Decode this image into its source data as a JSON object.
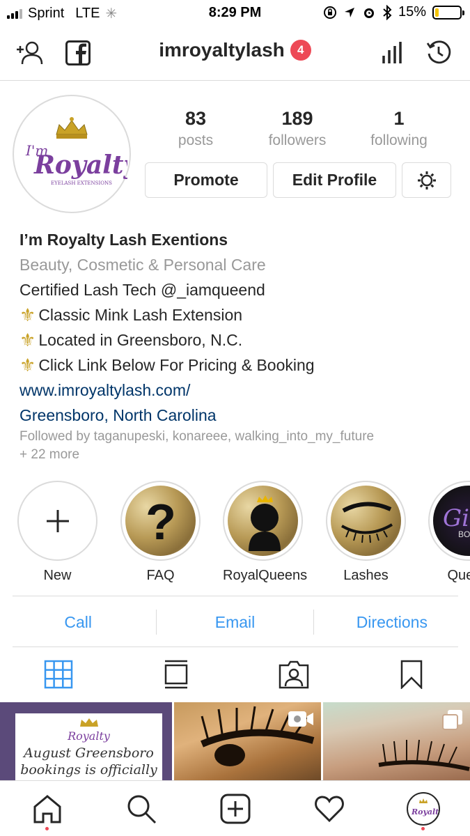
{
  "status_bar": {
    "carrier": "Sprint",
    "network": "LTE",
    "time": "8:29 PM",
    "battery_percent": "15%",
    "battery_level": 0.15,
    "battery_color": "#f5c400"
  },
  "header": {
    "username": "imroyaltylash",
    "notification_count": "4",
    "icons": [
      "add-person-icon",
      "facebook-icon",
      "insights-icon",
      "archive-icon"
    ]
  },
  "profile": {
    "avatar_text_top": "I'm",
    "avatar_text_main": "Royalty",
    "avatar_text_sub": "EYELASH EXTENSIONS",
    "stats": [
      {
        "value": "83",
        "label": "posts"
      },
      {
        "value": "189",
        "label": "followers"
      },
      {
        "value": "1",
        "label": "following"
      }
    ],
    "promote_label": "Promote",
    "edit_label": "Edit Profile"
  },
  "bio": {
    "name": "I’m Royalty Lash Exentions",
    "category": "Beauty, Cosmetic & Personal Care",
    "line1": "Certified Lash Tech @_iamqueend",
    "line2": "Classic Mink Lash Extension",
    "line3": "Located in Greensboro, N.C.",
    "line4": "Click Link Below For Pricing & Booking",
    "fleur": "⚜",
    "website": "www.imroyaltylash.com/",
    "location": "Greensboro, North Carolina",
    "followed_by": "Followed by taganupeski, konareee, walking_into_my_future",
    "followed_more": "+ 22 more"
  },
  "highlights": [
    {
      "label": "New"
    },
    {
      "label": "FAQ"
    },
    {
      "label": "RoyalQueens"
    },
    {
      "label": "Lashes"
    },
    {
      "label": "Queen"
    }
  ],
  "contact": {
    "call": "Call",
    "email": "Email",
    "directions": "Directions"
  },
  "posts": {
    "card_brand": "Royalty",
    "card_text_1": "August Greensboro",
    "card_text_2": "bookings is officially"
  },
  "colors": {
    "accent": "#3897f0",
    "link": "#003569",
    "badge": "#ed4956"
  }
}
